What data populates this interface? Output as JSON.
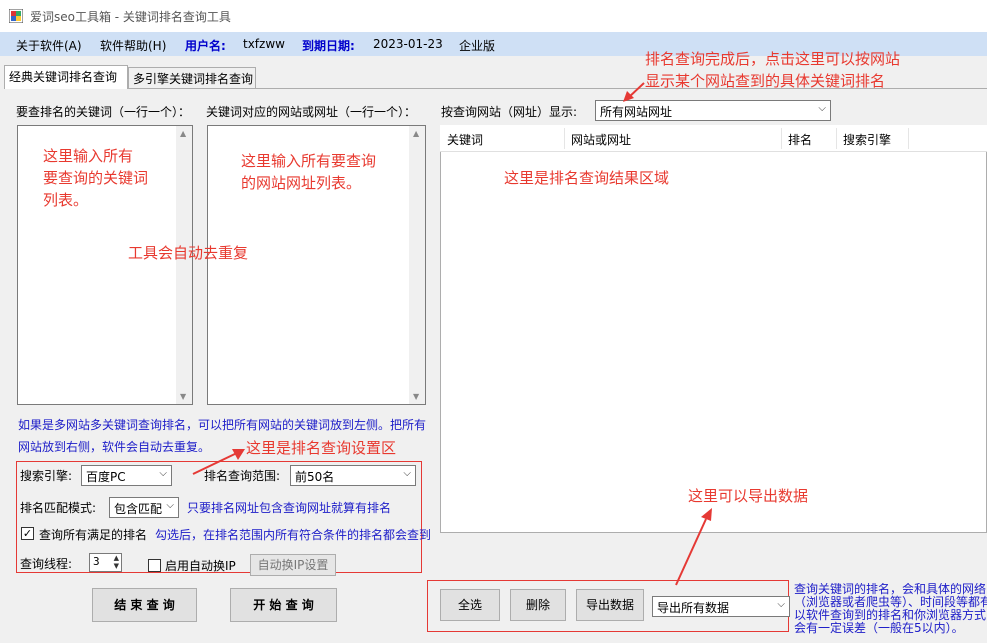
{
  "window": {
    "title": "爱词seo工具箱 - 关键词排名查询工具"
  },
  "menubar": {
    "about": "关于软件(A)",
    "help": "软件帮助(H)",
    "user_label": "用户名:",
    "user_value": "txfzww",
    "expire_label": "到期日期:",
    "expire_value": "2023-01-23",
    "edition": "企业版"
  },
  "tabs": [
    {
      "label": "经典关键词排名查询"
    },
    {
      "label": "多引擎关键词排名查询"
    }
  ],
  "left": {
    "keywords_label": "要查排名的关键词（一行一个）：",
    "sites_label": "关键词对应的网站或网址（一行一个）：",
    "note_keywords": "这里输入所有\n要查询的关键词\n列表。",
    "note_sites": "这里输入所有要查询\n的网站网址列表。",
    "note_dedupe": "工具会自动去重复",
    "info": "如果是多网站多关键词查询排名，可以把所有网站的关键词放到左侧。把所有\n网站放到右侧，软件会自动去重复。",
    "note_settings": "这里是排名查询设置区"
  },
  "settings": {
    "engine_label": "搜索引擎:",
    "engine_value": "百度PC",
    "range_label": "排名查询范围:",
    "range_value": "前50名",
    "match_label": "排名匹配模式:",
    "match_value": "包含匹配",
    "match_hint": "只要排名网址包含查询网址就算有排名",
    "query_all_label": "查询所有满足的排名",
    "query_all_hint": "勾选后，在排名范围内所有符合条件的排名都会查到",
    "threads_label": "查询线程:",
    "threads_value": "3",
    "auto_ip_label": "启用自动换IP",
    "auto_ip_button": "自动换IP设置"
  },
  "bottom_left": {
    "stop_button": "结 束 查 询",
    "start_button": "开 始 查 询"
  },
  "right": {
    "filter_label": "按查询网站（网址）显示:",
    "filter_value": "所有网站网址",
    "note_filter": "排名查询完成后，点击这里可以按网站\n显示某个网站查到的具体关键词排名",
    "columns": [
      "关键词",
      "网站或网址",
      "排名",
      "搜索引擎"
    ],
    "note_results": "这里是排名查询结果区域",
    "note_export": "这里可以导出数据"
  },
  "bottom_right": {
    "select_all_button": "全选",
    "delete_button": "删除",
    "export_button": "导出数据",
    "export_select": "导出所有数据",
    "notice": "查询关键词的排名，会和具体的网络\n（浏览器或者爬虫等）、时间段等都有\n以软件查询到的排名和你浏览器方式\n会有一定误差（一般在5以内）。"
  },
  "colors": {
    "accent_red": "#e8392f",
    "menu_blue": "#cfe0f5",
    "hint_blue": "#1c1cc8"
  }
}
